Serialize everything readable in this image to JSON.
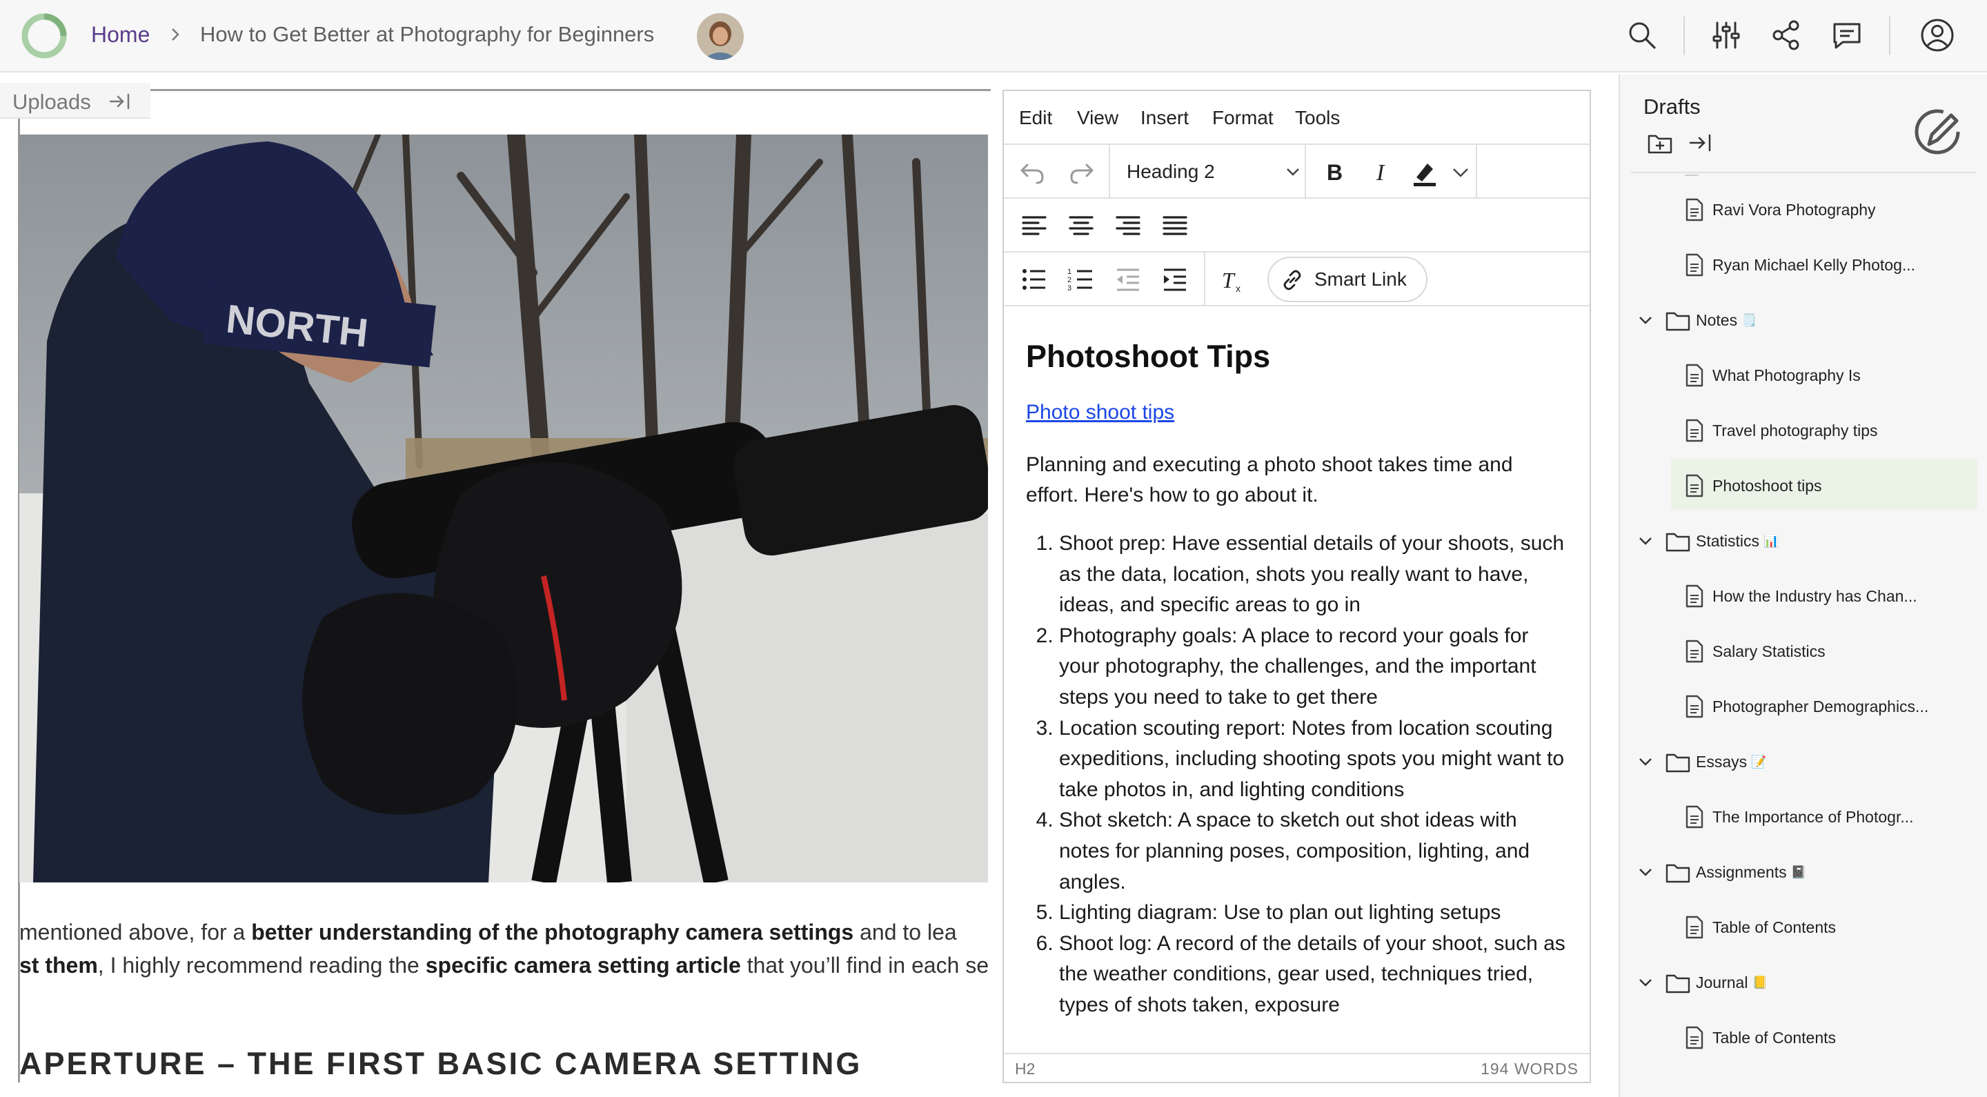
{
  "breadcrumb": {
    "home": "Home",
    "current": "How to Get Better at Photography for Beginners"
  },
  "toolbar_icons": [
    "search-icon",
    "sliders-icon",
    "share-icon",
    "comment-icon",
    "account-icon"
  ],
  "uploads_panel": {
    "label": "Uploads"
  },
  "article": {
    "line1": {
      "a": "mentioned above, for a ",
      "b": "better understanding of the photography camera settings",
      "c": " and to lea"
    },
    "line2": {
      "a": "st them",
      "b": ", I highly recommend reading the ",
      "c": "specific camera setting article",
      "d": " that you’ll find in each se"
    },
    "heading": "APERTURE – THE FIRST BASIC CAMERA SETTING"
  },
  "editor": {
    "menu": [
      "Edit",
      "View",
      "Insert",
      "Format",
      "Tools"
    ],
    "block_format": "Heading 2",
    "smart_link_label": "Smart Link",
    "title": "Photoshoot Tips",
    "link_text": "Photo shoot tips",
    "intro": "Planning and executing a photo shoot takes time and effort. Here's how to go about it.",
    "list": [
      "Shoot prep: Have essential details of your shoots, such as the data, location, shots you really want to have, ideas, and specific areas to go in",
      "Photography goals: A place to record your goals for your photography, the challenges, and the important steps you need to take to get there",
      "Location scouting report: Notes from location scouting expeditions, including shooting spots you might want to take photos in, and lighting conditions",
      "Shot sketch: A space to sketch out shot ideas with notes for planning poses, composition, lighting, and angles.",
      "Lighting diagram: Use to plan out lighting setups",
      "Shoot log: A record of the details of your shoot, such as the weather conditions, gear used, techniques tried, types of shots taken, exposure"
    ],
    "status_element": "H2",
    "word_count": "194 WORDS"
  },
  "sidebar": {
    "title": "Drafts",
    "items": {
      "i0": {
        "label": "Ravi Vora Photography"
      },
      "i1": {
        "label": "Ryan Michael Kelly Photog..."
      },
      "i2": {
        "label": "Notes",
        "emoji": "🗒️"
      },
      "i3": {
        "label": "What Photography Is"
      },
      "i4": {
        "label": "Travel photography tips"
      },
      "i5": {
        "label": "Photoshoot tips"
      },
      "i6": {
        "label": "Statistics",
        "emoji": "📊"
      },
      "i7": {
        "label": "How the Industry has Chan..."
      },
      "i8": {
        "label": "Salary Statistics"
      },
      "i9": {
        "label": "Photographer Demographics..."
      },
      "i10": {
        "label": "Essays",
        "emoji": "📝"
      },
      "i11": {
        "label": "The Importance of Photogr..."
      },
      "i12": {
        "label": "Assignments",
        "emoji": "📓"
      },
      "i13": {
        "label": "Table of Contents"
      },
      "i14": {
        "label": "Journal",
        "emoji": "📒"
      },
      "i15": {
        "label": "Table of Contents"
      }
    }
  },
  "colors": {
    "accent_purple": "#5a3d8a",
    "link_blue": "#1a47e6",
    "selected_bg": "#eaf3e6",
    "logo_green": "#9cc69a"
  }
}
